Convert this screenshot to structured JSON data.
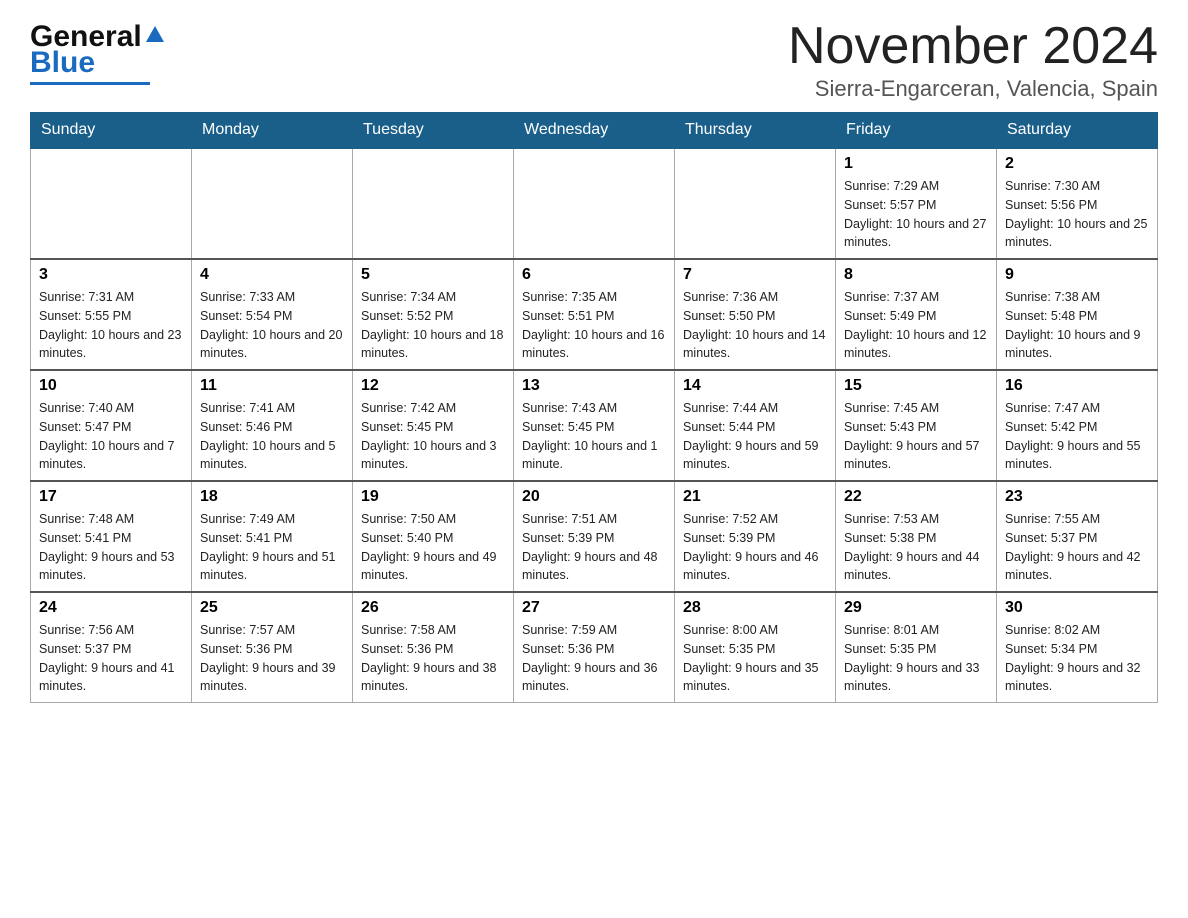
{
  "header": {
    "month_title": "November 2024",
    "location": "Sierra-Engarceran, Valencia, Spain",
    "logo_general": "General",
    "logo_blue": "Blue"
  },
  "days_of_week": [
    "Sunday",
    "Monday",
    "Tuesday",
    "Wednesday",
    "Thursday",
    "Friday",
    "Saturday"
  ],
  "weeks": [
    [
      {
        "day": "",
        "sunrise": "",
        "sunset": "",
        "daylight": ""
      },
      {
        "day": "",
        "sunrise": "",
        "sunset": "",
        "daylight": ""
      },
      {
        "day": "",
        "sunrise": "",
        "sunset": "",
        "daylight": ""
      },
      {
        "day": "",
        "sunrise": "",
        "sunset": "",
        "daylight": ""
      },
      {
        "day": "",
        "sunrise": "",
        "sunset": "",
        "daylight": ""
      },
      {
        "day": "1",
        "sunrise": "Sunrise: 7:29 AM",
        "sunset": "Sunset: 5:57 PM",
        "daylight": "Daylight: 10 hours and 27 minutes."
      },
      {
        "day": "2",
        "sunrise": "Sunrise: 7:30 AM",
        "sunset": "Sunset: 5:56 PM",
        "daylight": "Daylight: 10 hours and 25 minutes."
      }
    ],
    [
      {
        "day": "3",
        "sunrise": "Sunrise: 7:31 AM",
        "sunset": "Sunset: 5:55 PM",
        "daylight": "Daylight: 10 hours and 23 minutes."
      },
      {
        "day": "4",
        "sunrise": "Sunrise: 7:33 AM",
        "sunset": "Sunset: 5:54 PM",
        "daylight": "Daylight: 10 hours and 20 minutes."
      },
      {
        "day": "5",
        "sunrise": "Sunrise: 7:34 AM",
        "sunset": "Sunset: 5:52 PM",
        "daylight": "Daylight: 10 hours and 18 minutes."
      },
      {
        "day": "6",
        "sunrise": "Sunrise: 7:35 AM",
        "sunset": "Sunset: 5:51 PM",
        "daylight": "Daylight: 10 hours and 16 minutes."
      },
      {
        "day": "7",
        "sunrise": "Sunrise: 7:36 AM",
        "sunset": "Sunset: 5:50 PM",
        "daylight": "Daylight: 10 hours and 14 minutes."
      },
      {
        "day": "8",
        "sunrise": "Sunrise: 7:37 AM",
        "sunset": "Sunset: 5:49 PM",
        "daylight": "Daylight: 10 hours and 12 minutes."
      },
      {
        "day": "9",
        "sunrise": "Sunrise: 7:38 AM",
        "sunset": "Sunset: 5:48 PM",
        "daylight": "Daylight: 10 hours and 9 minutes."
      }
    ],
    [
      {
        "day": "10",
        "sunrise": "Sunrise: 7:40 AM",
        "sunset": "Sunset: 5:47 PM",
        "daylight": "Daylight: 10 hours and 7 minutes."
      },
      {
        "day": "11",
        "sunrise": "Sunrise: 7:41 AM",
        "sunset": "Sunset: 5:46 PM",
        "daylight": "Daylight: 10 hours and 5 minutes."
      },
      {
        "day": "12",
        "sunrise": "Sunrise: 7:42 AM",
        "sunset": "Sunset: 5:45 PM",
        "daylight": "Daylight: 10 hours and 3 minutes."
      },
      {
        "day": "13",
        "sunrise": "Sunrise: 7:43 AM",
        "sunset": "Sunset: 5:45 PM",
        "daylight": "Daylight: 10 hours and 1 minute."
      },
      {
        "day": "14",
        "sunrise": "Sunrise: 7:44 AM",
        "sunset": "Sunset: 5:44 PM",
        "daylight": "Daylight: 9 hours and 59 minutes."
      },
      {
        "day": "15",
        "sunrise": "Sunrise: 7:45 AM",
        "sunset": "Sunset: 5:43 PM",
        "daylight": "Daylight: 9 hours and 57 minutes."
      },
      {
        "day": "16",
        "sunrise": "Sunrise: 7:47 AM",
        "sunset": "Sunset: 5:42 PM",
        "daylight": "Daylight: 9 hours and 55 minutes."
      }
    ],
    [
      {
        "day": "17",
        "sunrise": "Sunrise: 7:48 AM",
        "sunset": "Sunset: 5:41 PM",
        "daylight": "Daylight: 9 hours and 53 minutes."
      },
      {
        "day": "18",
        "sunrise": "Sunrise: 7:49 AM",
        "sunset": "Sunset: 5:41 PM",
        "daylight": "Daylight: 9 hours and 51 minutes."
      },
      {
        "day": "19",
        "sunrise": "Sunrise: 7:50 AM",
        "sunset": "Sunset: 5:40 PM",
        "daylight": "Daylight: 9 hours and 49 minutes."
      },
      {
        "day": "20",
        "sunrise": "Sunrise: 7:51 AM",
        "sunset": "Sunset: 5:39 PM",
        "daylight": "Daylight: 9 hours and 48 minutes."
      },
      {
        "day": "21",
        "sunrise": "Sunrise: 7:52 AM",
        "sunset": "Sunset: 5:39 PM",
        "daylight": "Daylight: 9 hours and 46 minutes."
      },
      {
        "day": "22",
        "sunrise": "Sunrise: 7:53 AM",
        "sunset": "Sunset: 5:38 PM",
        "daylight": "Daylight: 9 hours and 44 minutes."
      },
      {
        "day": "23",
        "sunrise": "Sunrise: 7:55 AM",
        "sunset": "Sunset: 5:37 PM",
        "daylight": "Daylight: 9 hours and 42 minutes."
      }
    ],
    [
      {
        "day": "24",
        "sunrise": "Sunrise: 7:56 AM",
        "sunset": "Sunset: 5:37 PM",
        "daylight": "Daylight: 9 hours and 41 minutes."
      },
      {
        "day": "25",
        "sunrise": "Sunrise: 7:57 AM",
        "sunset": "Sunset: 5:36 PM",
        "daylight": "Daylight: 9 hours and 39 minutes."
      },
      {
        "day": "26",
        "sunrise": "Sunrise: 7:58 AM",
        "sunset": "Sunset: 5:36 PM",
        "daylight": "Daylight: 9 hours and 38 minutes."
      },
      {
        "day": "27",
        "sunrise": "Sunrise: 7:59 AM",
        "sunset": "Sunset: 5:36 PM",
        "daylight": "Daylight: 9 hours and 36 minutes."
      },
      {
        "day": "28",
        "sunrise": "Sunrise: 8:00 AM",
        "sunset": "Sunset: 5:35 PM",
        "daylight": "Daylight: 9 hours and 35 minutes."
      },
      {
        "day": "29",
        "sunrise": "Sunrise: 8:01 AM",
        "sunset": "Sunset: 5:35 PM",
        "daylight": "Daylight: 9 hours and 33 minutes."
      },
      {
        "day": "30",
        "sunrise": "Sunrise: 8:02 AM",
        "sunset": "Sunset: 5:34 PM",
        "daylight": "Daylight: 9 hours and 32 minutes."
      }
    ]
  ]
}
